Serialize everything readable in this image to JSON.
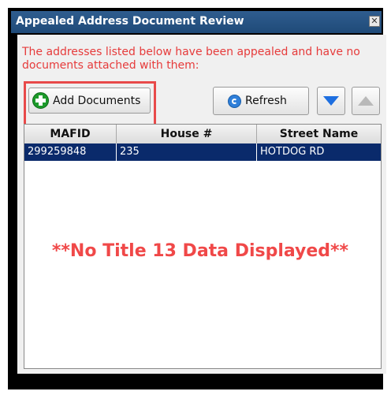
{
  "window": {
    "title": "Appealed Address Document Review",
    "close_symbol": "✕"
  },
  "message": "The addresses listed below have been appealed and have no documents attached with them:",
  "toolbar": {
    "add_documents_label": "Add Documents",
    "refresh_label": "Refresh"
  },
  "table": {
    "columns": [
      "MAFID",
      "House #",
      "Street Name"
    ],
    "rows": [
      {
        "mafid": "299259848",
        "house": "235",
        "street": "HOTDOG RD"
      }
    ]
  },
  "overlay_note": "**No Title 13 Data Displayed**",
  "colors": {
    "title_bar": "#1f4a78",
    "warning_text": "#e63b3b",
    "selection": "#0a2a6b",
    "highlight_border": "#e84a4a"
  }
}
